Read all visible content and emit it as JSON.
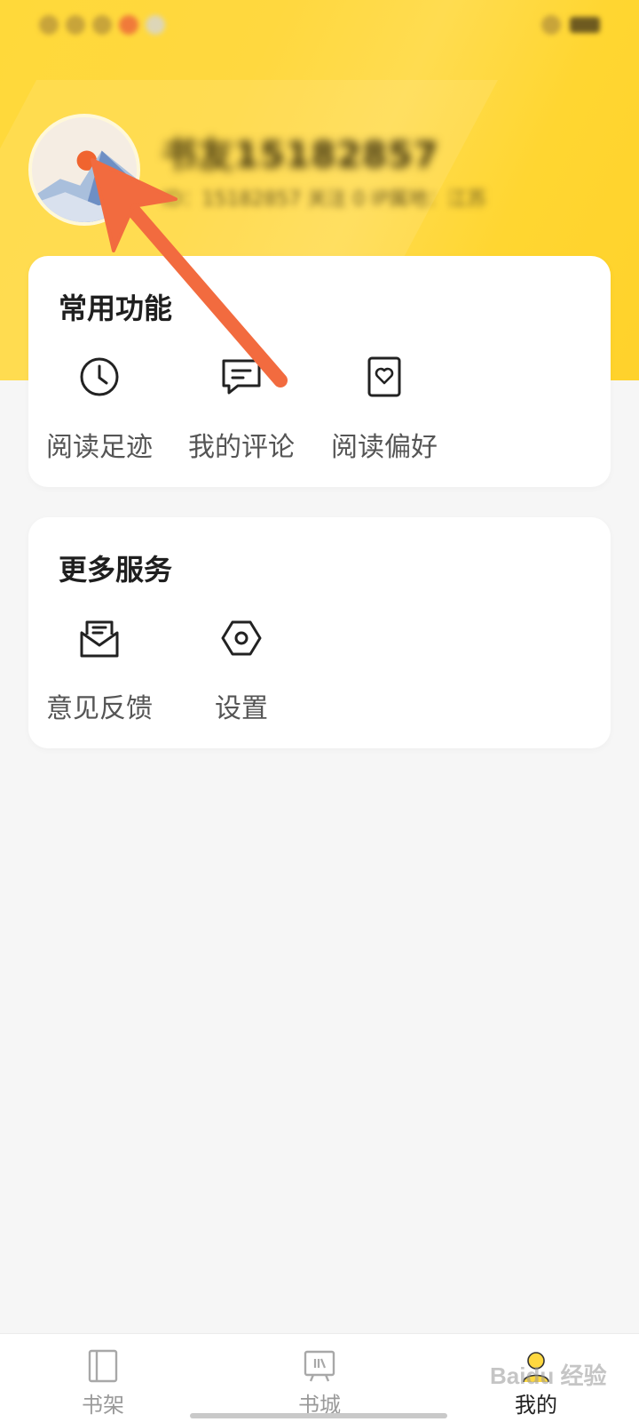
{
  "header": {
    "user_name": "书友15182857",
    "user_meta": "ID：15182857   关注 0   IP属地：江苏"
  },
  "common_functions": {
    "title": "常用功能",
    "items": [
      {
        "label": "阅读足迹",
        "icon": "clock-icon"
      },
      {
        "label": "我的评论",
        "icon": "comment-icon"
      },
      {
        "label": "阅读偏好",
        "icon": "heart-card-icon"
      }
    ]
  },
  "more_services": {
    "title": "更多服务",
    "items": [
      {
        "label": "意见反馈",
        "icon": "feedback-envelope-icon"
      },
      {
        "label": "设置",
        "icon": "settings-hexagon-icon"
      }
    ]
  },
  "bottom_nav": {
    "items": [
      {
        "label": "书架",
        "icon": "bookshelf-icon",
        "active": false
      },
      {
        "label": "书城",
        "icon": "bookstore-icon",
        "active": false
      },
      {
        "label": "我的",
        "icon": "profile-icon",
        "active": true
      }
    ]
  },
  "colors": {
    "header_yellow": "#ffd83f",
    "annotation_arrow": "#f26b3f",
    "background": "#f6f6f6"
  }
}
